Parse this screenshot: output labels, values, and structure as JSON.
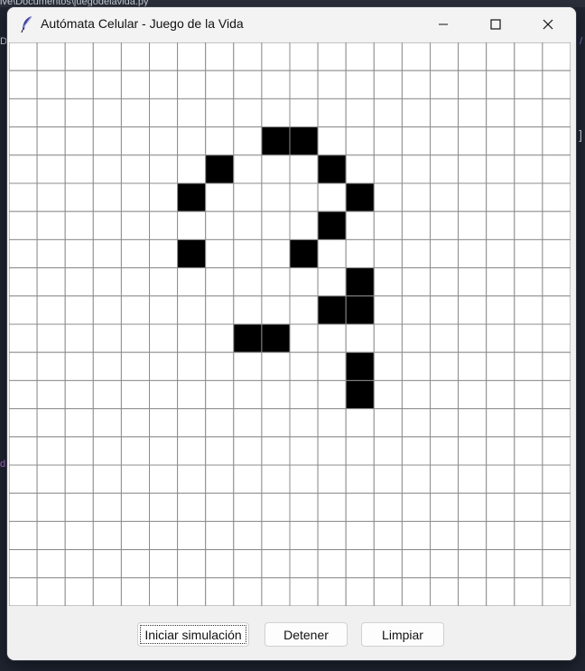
{
  "window": {
    "title": "Autómata Celular - Juego de la Vida",
    "icon": "feather-icon",
    "controls": {
      "minimize": "minimize-icon",
      "maximize": "maximize-icon",
      "close": "close-icon"
    }
  },
  "background": {
    "path_fragment": "ive\\Documentos\\juegodelavida.py",
    "left_fragment": "D",
    "left_purple_fragment": "d",
    "right_bracket": "]",
    "right_slash": "/"
  },
  "grid": {
    "columns": 20,
    "rows": 20,
    "live_color": "#000000",
    "dead_color": "#ffffff",
    "line_color": "#8c8c8c",
    "live_cells": [
      [
        3,
        9
      ],
      [
        3,
        10
      ],
      [
        4,
        7
      ],
      [
        4,
        11
      ],
      [
        5,
        6
      ],
      [
        5,
        12
      ],
      [
        6,
        11
      ],
      [
        7,
        6
      ],
      [
        7,
        10
      ],
      [
        8,
        12
      ],
      [
        9,
        11
      ],
      [
        9,
        12
      ],
      [
        10,
        8
      ],
      [
        10,
        9
      ],
      [
        11,
        12
      ],
      [
        12,
        12
      ]
    ]
  },
  "buttons": {
    "start": "Iniciar simulación",
    "stop": "Detener",
    "clear": "Limpiar"
  }
}
